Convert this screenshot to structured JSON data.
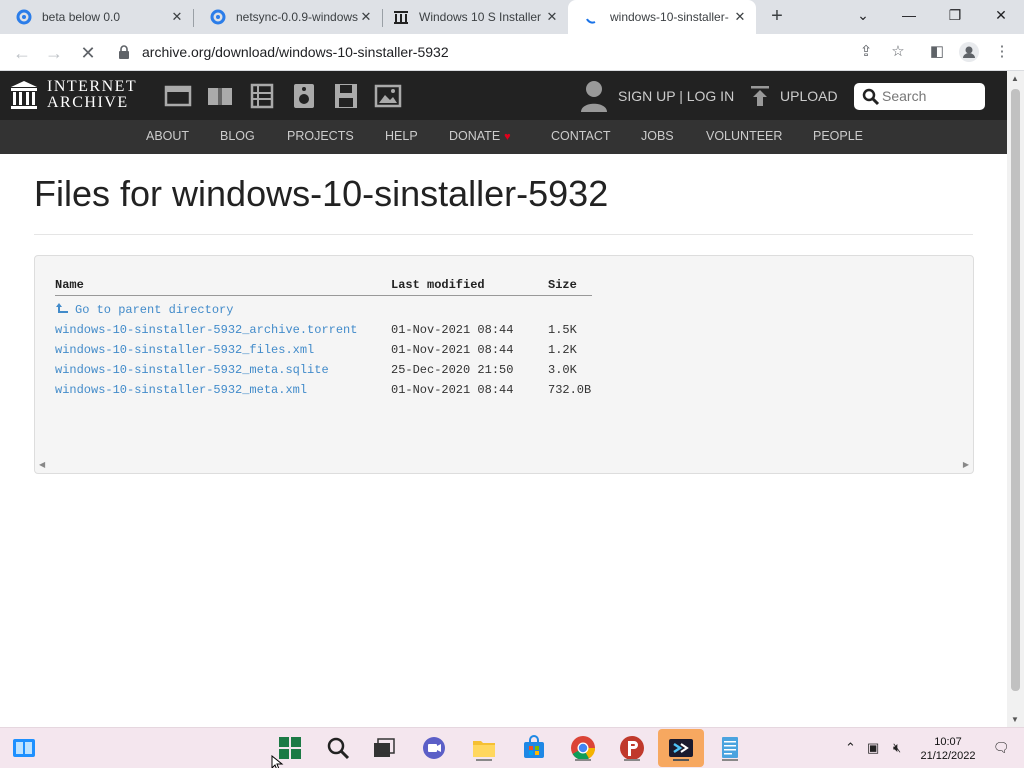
{
  "browser": {
    "tabs": [
      {
        "title": "beta below 0.0",
        "favicon": "blue-swirl-icon"
      },
      {
        "title": "netsync-0.0.9-windows",
        "favicon": "blue-swirl-icon"
      },
      {
        "title": "Windows 10 S Installer",
        "favicon": "internet-archive-icon"
      },
      {
        "title": "windows-10-sinstaller-",
        "favicon": "loading-spinner-icon",
        "active": true
      }
    ],
    "new_tab_label": "+",
    "close_label": "✕",
    "url": "archive.org/download/windows-10-sinstaller-5932"
  },
  "ia_header": {
    "logo_line1": "INTERNET",
    "logo_line2": "ARCHIVE",
    "signup_label": "SIGN UP | LOG IN",
    "upload_label": "UPLOAD",
    "search_placeholder": "Search",
    "nav": [
      "ABOUT",
      "BLOG",
      "PROJECTS",
      "HELP",
      "DONATE",
      "CONTACT",
      "JOBS",
      "VOLUNTEER",
      "PEOPLE"
    ],
    "donate_heart": "♥"
  },
  "page": {
    "title": "Files for windows-10-sinstaller-5932",
    "columns": {
      "name": "Name",
      "modified": "Last modified",
      "size": "Size"
    },
    "parent_dir": "Go to parent directory",
    "files": [
      {
        "name": "windows-10-sinstaller-5932_archive.torrent",
        "modified": "01-Nov-2021 08:44",
        "size": "1.5K"
      },
      {
        "name": "windows-10-sinstaller-5932_files.xml",
        "modified": "01-Nov-2021 08:44",
        "size": "1.2K"
      },
      {
        "name": "windows-10-sinstaller-5932_meta.sqlite",
        "modified": "25-Dec-2020 21:50",
        "size": "3.0K"
      },
      {
        "name": "windows-10-sinstaller-5932_meta.xml",
        "modified": "01-Nov-2021 08:44",
        "size": "732.0B"
      }
    ]
  },
  "taskbar": {
    "apps": [
      "widgets-icon",
      "start-icon",
      "search-icon",
      "task-view-icon",
      "meet-icon",
      "file-explorer-icon",
      "store-icon",
      "chrome-icon",
      "papers-icon",
      "terminal-icon",
      "notepad-icon"
    ],
    "time": "10:07",
    "date": "21/12/2022"
  },
  "colors": {
    "ia_header": "#222222",
    "ia_nav": "#333333",
    "link": "#428bca",
    "taskbar": "#f4e6ee"
  }
}
